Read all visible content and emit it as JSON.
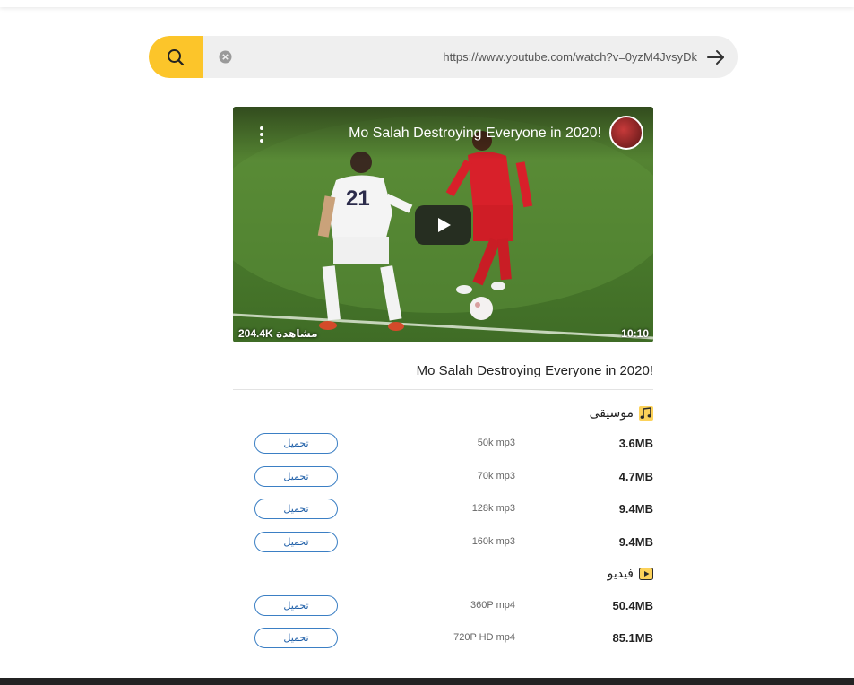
{
  "search": {
    "url_value": "https://www.youtube.com/watch?v=0yzM4JvsyDk"
  },
  "video": {
    "overlay_title": "Mo Salah Destroying Everyone in 2020!",
    "views": "204.4K مشاهدة",
    "duration": "10:10",
    "jersey_number": "21"
  },
  "main": {
    "title": "Mo Salah Destroying Everyone in 2020!"
  },
  "music": {
    "heading": "موسيقى",
    "rows": [
      {
        "size": "3.6MB",
        "format": "50k mp3",
        "button": "تحميل"
      },
      {
        "size": "4.7MB",
        "format": "70k mp3",
        "button": "تحميل"
      },
      {
        "size": "9.4MB",
        "format": "128k mp3",
        "button": "تحميل"
      },
      {
        "size": "9.4MB",
        "format": "160k mp3",
        "button": "تحميل"
      }
    ]
  },
  "videos": {
    "heading": "فيديو",
    "rows": [
      {
        "size": "50.4MB",
        "format": "360P mp4",
        "button": "تحميل"
      },
      {
        "size": "85.1MB",
        "format": "720P HD mp4",
        "button": "تحميل"
      }
    ]
  },
  "colors": {
    "accent": "#fcc52a",
    "button_border": "#3b7fc4",
    "footer": "#232323"
  }
}
